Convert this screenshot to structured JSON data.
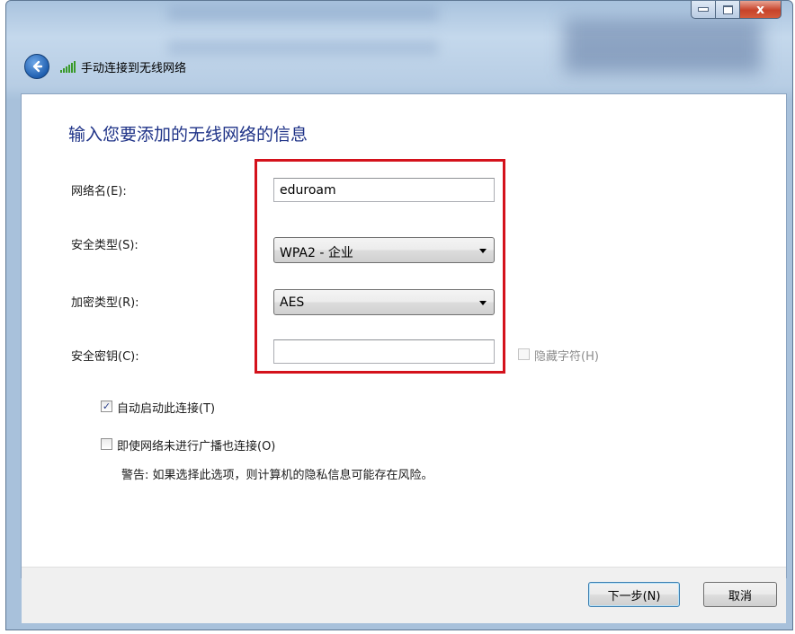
{
  "window": {
    "title": "手动连接到无线网络",
    "close_glyph": "x"
  },
  "page": {
    "heading": "输入您要添加的无线网络的信息"
  },
  "form": {
    "network_name": {
      "label": "网络名(E):",
      "value": "eduroam"
    },
    "security_type": {
      "label": "安全类型(S):",
      "value": "WPA2 - 企业"
    },
    "encryption_type": {
      "label": "加密类型(R):",
      "value": "AES"
    },
    "security_key": {
      "label": "安全密钥(C):",
      "value": ""
    },
    "hide_chars": {
      "label": "隐藏字符(H)",
      "checked": false,
      "enabled": false
    }
  },
  "options": {
    "auto_connect": {
      "label": "自动启动此连接(T)",
      "checked": true
    },
    "connect_hidden": {
      "label": "即使网络未进行广播也连接(O)",
      "checked": false
    },
    "warning": "警告: 如果选择此选项，则计算机的隐私信息可能存在风险。"
  },
  "buttons": {
    "next": "下一步(N)",
    "cancel": "取消"
  },
  "colors": {
    "heading": "#1e3287",
    "highlight_box": "#d4121c",
    "close_button": "#c7432a"
  },
  "icons": [
    "back-arrow-icon",
    "wireless-signal-icon",
    "minimize-icon",
    "maximize-icon",
    "close-icon",
    "checkmark-icon",
    "dropdown-arrow-icon"
  ]
}
